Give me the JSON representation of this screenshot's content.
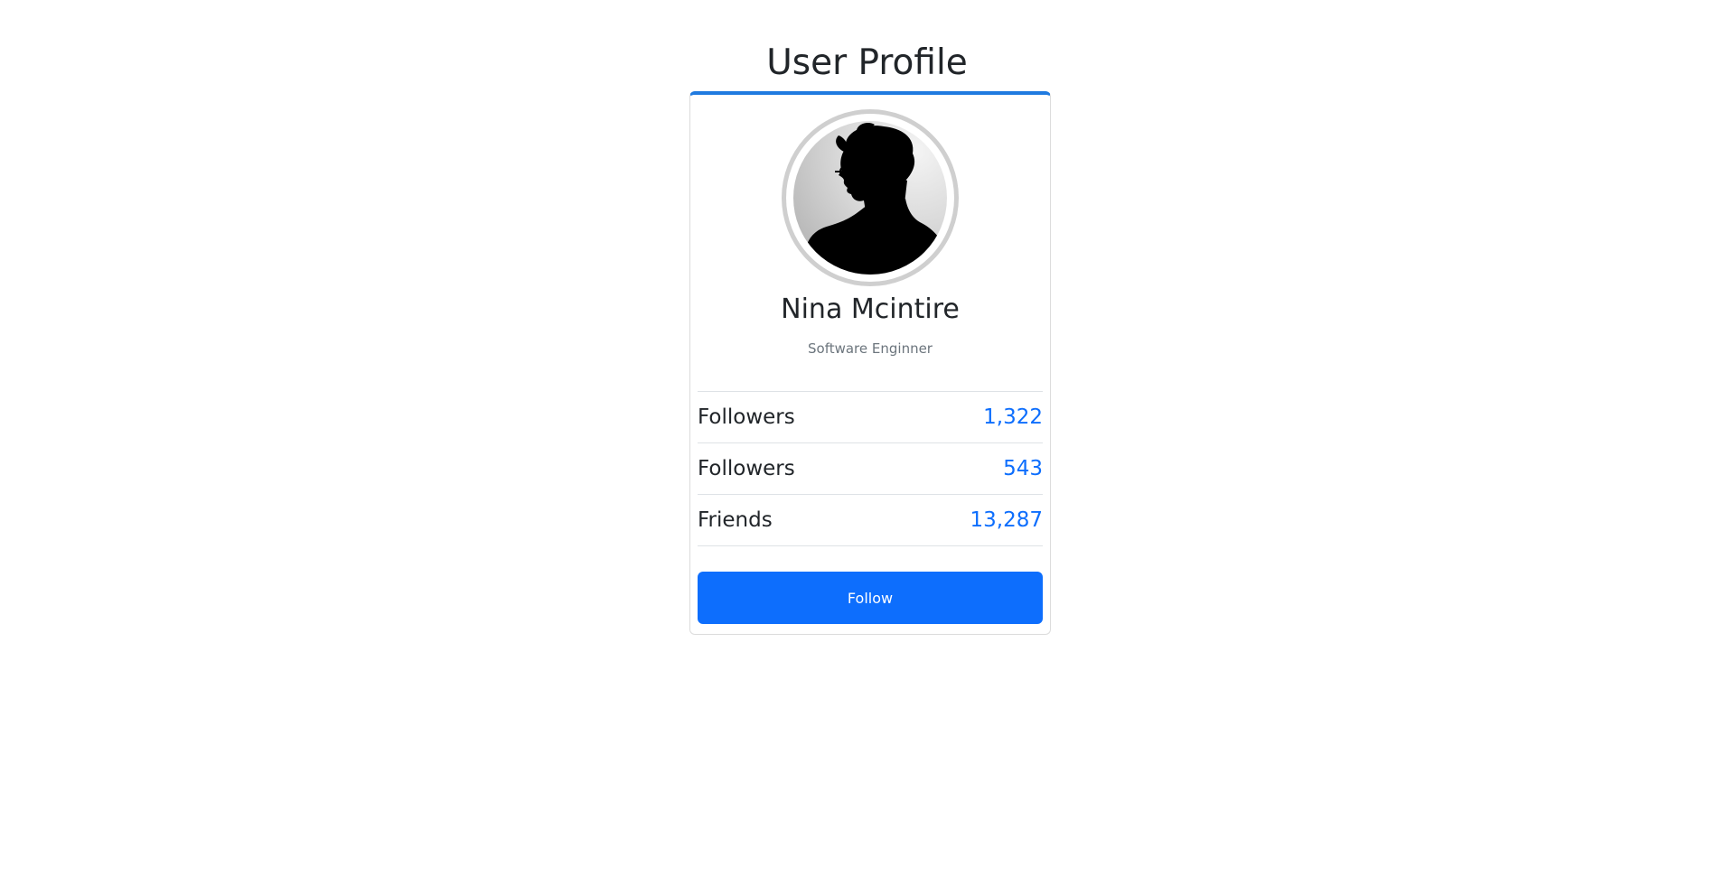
{
  "page": {
    "title": "User Profile"
  },
  "profile": {
    "name": "Nina Mcintire",
    "role": "Software Enginner",
    "avatar_icon": "user-silhouette-photo",
    "stats": [
      {
        "label": "Followers",
        "value": "1,322"
      },
      {
        "label": "Followers",
        "value": "543"
      },
      {
        "label": "Friends",
        "value": "13,287"
      }
    ],
    "follow_label": "Follow"
  },
  "colors": {
    "accent": "#0d6efd",
    "card_top_border": "#1f7ae0",
    "muted_text": "#6c757d",
    "text": "#212529",
    "divider": "#dee2e6"
  }
}
